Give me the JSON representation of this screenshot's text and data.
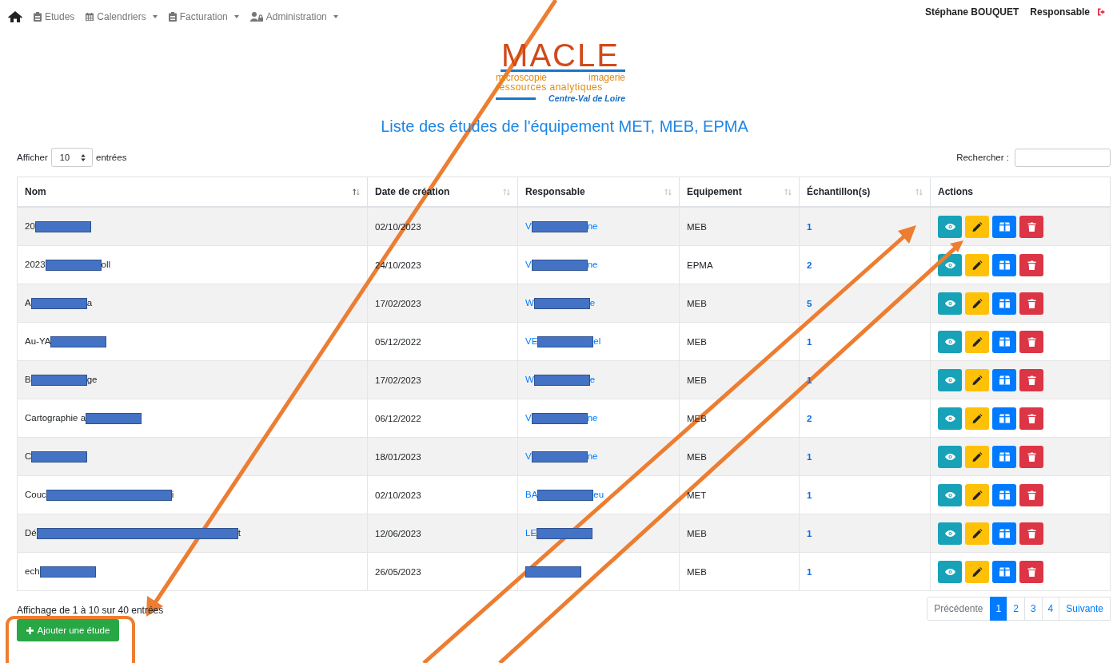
{
  "nav": {
    "items": [
      {
        "label": "Etudes",
        "dropdown": false
      },
      {
        "label": "Calendriers",
        "dropdown": true
      },
      {
        "label": "Facturation",
        "dropdown": true
      },
      {
        "label": "Administration",
        "dropdown": true
      }
    ],
    "user": "Stéphane BOUQUET",
    "role": "Responsable"
  },
  "logo": {
    "name": "MACLE",
    "line_1_left": "microscopie",
    "line_1_right": "imagerie",
    "line_2": "ressources analytiques",
    "region": "Centre-Val de Loire"
  },
  "title": "Liste des études de l'équipement MET, MEB, EPMA",
  "length_control": {
    "before": "Afficher",
    "value": "10",
    "after": "entrées"
  },
  "search": {
    "label": "Rechercher :"
  },
  "table": {
    "columns": [
      {
        "label": "Nom",
        "sorted": true
      },
      {
        "label": "Date de création",
        "sorted": false
      },
      {
        "label": "Responsable",
        "sorted": false
      },
      {
        "label": "Equipement",
        "sorted": false
      },
      {
        "label": "Échantillon(s)",
        "sorted": false
      },
      {
        "label": "Actions"
      }
    ],
    "rows": [
      {
        "name": {
          "start": "20"
        },
        "date": "02/10/2023",
        "responsable": {
          "start": "V",
          "end": "ne"
        },
        "equipement": "MEB",
        "samples": "1"
      },
      {
        "name": {
          "start": "2023",
          "end": "oll"
        },
        "date": "24/10/2023",
        "responsable": {
          "start": "V",
          "end": "ne"
        },
        "equipement": "EPMA",
        "samples": "2"
      },
      {
        "name": {
          "start": "A",
          "end": "a"
        },
        "date": "17/02/2023",
        "responsable": {
          "start": "W",
          "end": "e"
        },
        "equipement": "MEB",
        "samples": "5"
      },
      {
        "name": {
          "start": "Au-YA"
        },
        "date": "05/12/2022",
        "responsable": {
          "start": "VE",
          "end": "el"
        },
        "equipement": "MEB",
        "samples": "1"
      },
      {
        "name": {
          "start": "B",
          "end": "ge"
        },
        "date": "17/02/2023",
        "responsable": {
          "start": "W",
          "end": "e"
        },
        "equipement": "MEB",
        "samples": "1"
      },
      {
        "name": {
          "start": "Cartographie a"
        },
        "date": "06/12/2022",
        "responsable": {
          "start": "V",
          "end": "ne"
        },
        "equipement": "MEB",
        "samples": "2"
      },
      {
        "name": {
          "start": "C"
        },
        "date": "18/01/2023",
        "responsable": {
          "start": "V",
          "end": "ne"
        },
        "equipement": "MEB",
        "samples": "1"
      },
      {
        "name": {
          "start": "Couc",
          "end": "i"
        },
        "date": "02/10/2023",
        "responsable": {
          "start": "BA",
          "end": "eu"
        },
        "equipement": "MET",
        "samples": "1"
      },
      {
        "name": {
          "start": "Dé",
          "end": "t"
        },
        "date": "12/06/2023",
        "responsable": {
          "start": "LE"
        },
        "equipement": "MEB",
        "samples": "1"
      },
      {
        "name": {
          "start": "ech"
        },
        "date": "26/05/2023",
        "responsable": {},
        "equipement": "MEB",
        "samples": "1"
      }
    ]
  },
  "info": "Affichage de 1 à 10 sur 40 entrées",
  "pagination": [
    {
      "label": "Précédente",
      "kind": "nav",
      "selected": false
    },
    {
      "label": "1",
      "kind": "page",
      "selected": true
    },
    {
      "label": "2",
      "kind": "page",
      "selected": false
    },
    {
      "label": "3",
      "kind": "page",
      "selected": false
    },
    {
      "label": "4",
      "kind": "page",
      "selected": false
    },
    {
      "label": "Suivante",
      "kind": "nav",
      "selected": false
    }
  ],
  "add_button": "Ajouter une étude"
}
